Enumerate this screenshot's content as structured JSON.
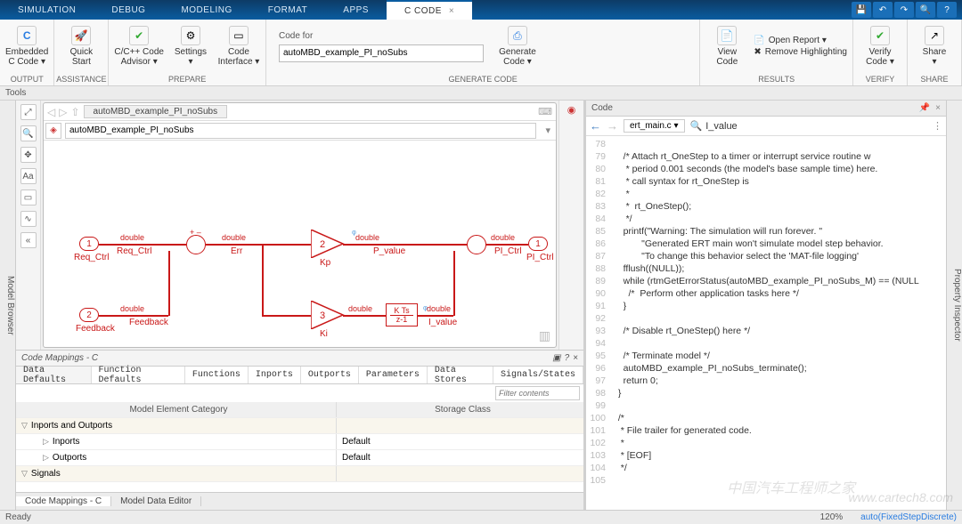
{
  "menu": {
    "tabs": [
      "SIMULATION",
      "DEBUG",
      "MODELING",
      "FORMAT",
      "APPS",
      "C CODE"
    ],
    "active": 5
  },
  "ribbon": {
    "output": {
      "label": "OUTPUT",
      "btn1": "Embedded\nC Code ▾"
    },
    "assist": {
      "label": "ASSISTANCE",
      "btn1": "Quick\nStart"
    },
    "prepare": {
      "label": "PREPARE",
      "btn1": "C/C++ Code\nAdvisor ▾",
      "btn2": "Settings\n▾",
      "btn3": "Code\nInterface ▾"
    },
    "gen": {
      "label": "GENERATE CODE",
      "codefor": "Code for",
      "codefor_val": "autoMBD_example_PI_noSubs",
      "btn1": "Generate\nCode ▾"
    },
    "results": {
      "label": "RESULTS",
      "btn1": "View\nCode",
      "open": "Open Report ▾",
      "remove": "Remove Highlighting"
    },
    "verify": {
      "label": "VERIFY",
      "btn1": "Verify\nCode ▾"
    },
    "share": {
      "label": "SHARE",
      "btn1": "Share\n▾"
    }
  },
  "tools_label": "Tools",
  "browser_tab": "Model Browser",
  "inspector_tab": "Property Inspector",
  "crumb": "autoMBD_example_PI_noSubs",
  "addr": "autoMBD_example_PI_noSubs",
  "diagram": {
    "in1": "1",
    "in1_lbl": "Req_Ctrl",
    "in2": "2",
    "in2_lbl": "Feedback",
    "out1": "1",
    "out1_lbl": "PI_Ctrl",
    "sum1_lbl": "Err",
    "kp": "2",
    "kp_lbl": "Kp",
    "p_lbl": "P_value",
    "ki": "3",
    "ki_lbl": "Ki",
    "tf_n": "K Ts",
    "tf_d": "z-1",
    "i_lbl": "I_value",
    "pi_lbl": "PI_Ctrl",
    "dt": "double"
  },
  "mappings": {
    "title": "Code Mappings - C",
    "tabs": [
      "Data Defaults",
      "Function Defaults",
      "Functions",
      "Inports",
      "Outports",
      "Parameters",
      "Data Stores",
      "Signals/States"
    ],
    "filter_ph": "Filter contents",
    "col1": "Model Element Category",
    "col2": "Storage Class",
    "rows": [
      {
        "group": true,
        "name": "Inports and Outports"
      },
      {
        "name": "Inports",
        "val": "Default"
      },
      {
        "name": "Outports",
        "val": "Default"
      },
      {
        "group": true,
        "name": "Signals"
      }
    ],
    "foot": [
      "Code Mappings - C",
      "Model Data Editor"
    ]
  },
  "code": {
    "title": "Code",
    "file": "ert_main.c",
    "search": "I_value",
    "lines": [
      {
        "n": 78,
        "t": ""
      },
      {
        "n": 79,
        "t": "    /* Attach rt_OneStep to a timer or interrupt service routine w",
        "cls": "cmt"
      },
      {
        "n": 80,
        "t": "     * period 0.001 seconds (the model's base sample time) here.",
        "cls": "cmt"
      },
      {
        "n": 81,
        "t": "     * call syntax for rt_OneStep is",
        "cls": "cmt"
      },
      {
        "n": 82,
        "t": "     *",
        "cls": "cmt"
      },
      {
        "n": 83,
        "t": "     *  rt_OneStep();",
        "cls": "cmt"
      },
      {
        "n": 84,
        "t": "     */",
        "cls": "cmt"
      },
      {
        "n": 85,
        "t": "    printf(\"Warning: The simulation will run forever. \"",
        "cls": "str"
      },
      {
        "n": 86,
        "t": "           \"Generated ERT main won't simulate model step behavior.",
        "cls": "str"
      },
      {
        "n": 87,
        "t": "           \"To change this behavior select the 'MAT-file logging'",
        "cls": "str"
      },
      {
        "n": 88,
        "t": "    fflush((NULL));"
      },
      {
        "n": 89,
        "t": "    while (rtmGetErrorStatus(autoMBD_example_PI_noSubs_M) == (NULL"
      },
      {
        "n": 90,
        "t": "      /*  Perform other application tasks here */",
        "cls": "cmt"
      },
      {
        "n": 91,
        "t": "    }"
      },
      {
        "n": 92,
        "t": ""
      },
      {
        "n": 93,
        "t": "    /* Disable rt_OneStep() here */",
        "cls": "cmt"
      },
      {
        "n": 94,
        "t": ""
      },
      {
        "n": 95,
        "t": "    /* Terminate model */",
        "cls": "cmt"
      },
      {
        "n": 96,
        "t": "    autoMBD_example_PI_noSubs_terminate();"
      },
      {
        "n": 97,
        "t": "    return 0;",
        "cls": "kw"
      },
      {
        "n": 98,
        "t": "  }"
      },
      {
        "n": 99,
        "t": ""
      },
      {
        "n": 100,
        "t": "  /*",
        "cls": "cmt"
      },
      {
        "n": 101,
        "t": "   * File trailer for generated code.",
        "cls": "cmt"
      },
      {
        "n": 102,
        "t": "   *",
        "cls": "cmt"
      },
      {
        "n": 103,
        "t": "   * [EOF]",
        "cls": "cmt"
      },
      {
        "n": 104,
        "t": "   */",
        "cls": "cmt"
      },
      {
        "n": 105,
        "t": ""
      }
    ]
  },
  "status": {
    "ready": "Ready",
    "zoom": "120%",
    "solver": "auto(FixedStepDiscrete)"
  },
  "wm1": "www.cartech8.com",
  "wm2": "中国汽车工程师之家"
}
